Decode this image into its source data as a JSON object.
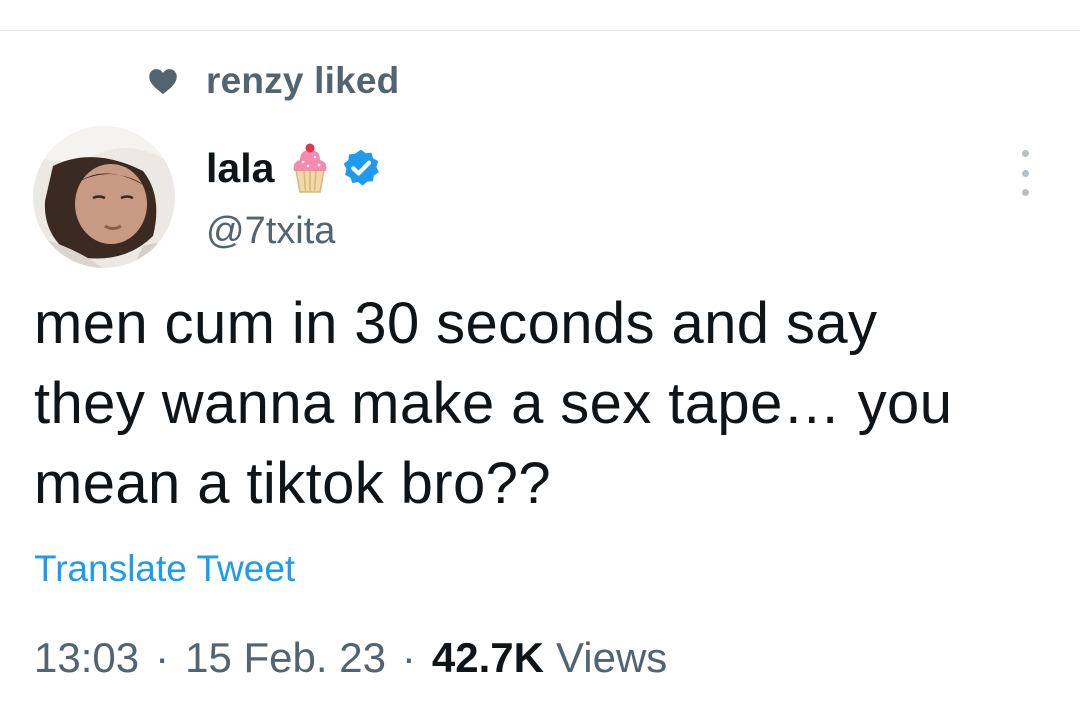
{
  "social_context": {
    "icon": "heart-icon",
    "text": "renzy liked"
  },
  "tweet": {
    "author": {
      "display_name": "lala",
      "emoji_icon": "cupcake-emoji-icon",
      "verified_icon": "verified-badge-icon",
      "handle": "@7txita",
      "avatar": "profile-photo"
    },
    "text": "men cum in 30 seconds and say\nthey wanna make a sex tape… you\nmean a tiktok bro??",
    "translate_label": "Translate Tweet",
    "time": "13:03",
    "separator": "·",
    "date": "15 Feb. 23",
    "views_count": "42.7K",
    "views_label": "Views"
  },
  "colors": {
    "text_primary": "#0f1419",
    "text_secondary": "#536471",
    "link": "#1d9bf0",
    "verified": "#1d9bf0"
  }
}
